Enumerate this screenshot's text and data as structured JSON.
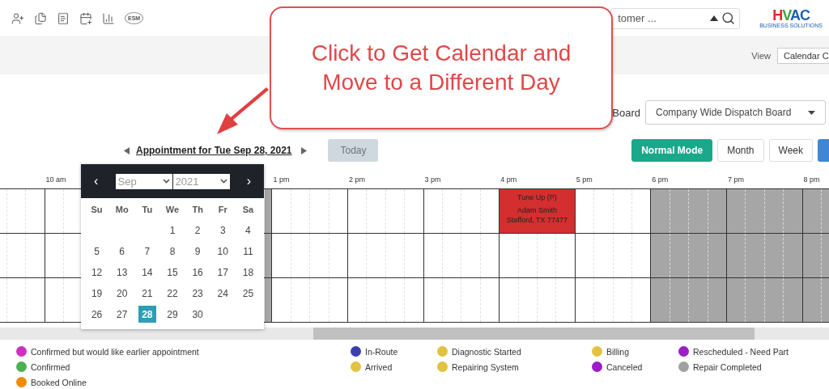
{
  "toolbar": {
    "esm": "ESM"
  },
  "search": {
    "placeholder": "tomer ..."
  },
  "logo": {
    "letters": [
      {
        "text": "H",
        "color": "#e02a2a"
      },
      {
        "text": "V",
        "color": "#3aa53a"
      },
      {
        "text": "AC",
        "color": "#1c5fb3"
      }
    ],
    "tagline": "BUSINESS SOLUTIONS"
  },
  "view": {
    "label": "View",
    "value": "Calendar C"
  },
  "board": {
    "label": "Board",
    "value": "Company Wide Dispatch Board"
  },
  "date_nav": {
    "title": "Appointment for Tue Sep 28, 2021",
    "today": "Today"
  },
  "modes": [
    {
      "label": "Normal Mode",
      "selected": true
    },
    {
      "label": "Month",
      "selected": false
    },
    {
      "label": "Week",
      "selected": false
    }
  ],
  "timeline": {
    "hours": [
      {
        "off": false
      },
      {
        "label": "10 am",
        "off": false
      },
      {
        "kind": "covered"
      },
      {
        "label": "1 pm",
        "off": false
      },
      {
        "label": "2 pm",
        "off": false
      },
      {
        "label": "3 pm",
        "off": false
      },
      {
        "label": "4 pm",
        "off": false,
        "event": {
          "title": "Tune Up (P)",
          "customer": "Adam Smith",
          "address": "Stafford, TX 77477"
        }
      },
      {
        "label": "5 pm",
        "off": false
      },
      {
        "label": "6 pm",
        "off": true
      },
      {
        "label": "7 pm",
        "off": true
      },
      {
        "label": "8 pm",
        "off": true
      }
    ]
  },
  "datepicker": {
    "prev": "‹",
    "next": "›",
    "month": "Sep",
    "year": "2021",
    "weekdays": [
      "Su",
      "Mo",
      "Tu",
      "We",
      "Th",
      "Fr",
      "Sa"
    ],
    "weeks": [
      [
        {
          "day": "1",
          "selected": false
        },
        {
          "day": "2",
          "selected": false
        },
        {
          "day": "3",
          "selected": false
        },
        {
          "day": "4",
          "selected": false
        }
      ],
      [
        {
          "day": "5",
          "selected": false
        },
        {
          "day": "6",
          "selected": false
        },
        {
          "day": "7",
          "selected": false
        },
        {
          "day": "8",
          "selected": false
        },
        {
          "day": "9",
          "selected": false
        },
        {
          "day": "10",
          "selected": false
        },
        {
          "day": "11",
          "selected": false
        }
      ],
      [
        {
          "day": "12",
          "selected": false
        },
        {
          "day": "13",
          "selected": false
        },
        {
          "day": "14",
          "selected": false
        },
        {
          "day": "15",
          "selected": false
        },
        {
          "day": "16",
          "selected": false
        },
        {
          "day": "17",
          "selected": false
        },
        {
          "day": "18",
          "selected": false
        }
      ],
      [
        {
          "day": "19",
          "selected": false
        },
        {
          "day": "20",
          "selected": false
        },
        {
          "day": "21",
          "selected": false
        },
        {
          "day": "22",
          "selected": false
        },
        {
          "day": "23",
          "selected": false
        },
        {
          "day": "24",
          "selected": false
        },
        {
          "day": "25",
          "selected": false
        }
      ],
      [
        {
          "day": "26",
          "selected": false
        },
        {
          "day": "27",
          "selected": false
        },
        {
          "day": "28",
          "selected": true
        },
        {
          "day": "29",
          "selected": false
        },
        {
          "day": "30",
          "selected": false
        }
      ]
    ]
  },
  "legend": [
    {
      "label": "Confirmed but would like earlier appointment",
      "color": "#d030c0"
    },
    {
      "label": "In-Route",
      "color": "#3a3fb0"
    },
    {
      "label": "Diagnostic Started",
      "color": "#e3c23f"
    },
    {
      "label": "Billing",
      "color": "#e3c23f"
    },
    {
      "label": "Rescheduled - Need Part",
      "color": "#9b1ec8"
    },
    {
      "label": "Confirmed",
      "color": "#4caf50"
    },
    {
      "label": "Arrived",
      "color": "#e3c23f"
    },
    {
      "label": "Repairing System",
      "color": "#e3c23f"
    },
    {
      "label": "Canceled",
      "color": "#9b1ec8"
    },
    {
      "label": "Repair Completed",
      "color": "#a0a0a0"
    },
    {
      "label": "Booked Online",
      "color": "#f08c00"
    }
  ],
  "callout": {
    "text": "Click to Get Calendar and Move to a Different Day"
  }
}
